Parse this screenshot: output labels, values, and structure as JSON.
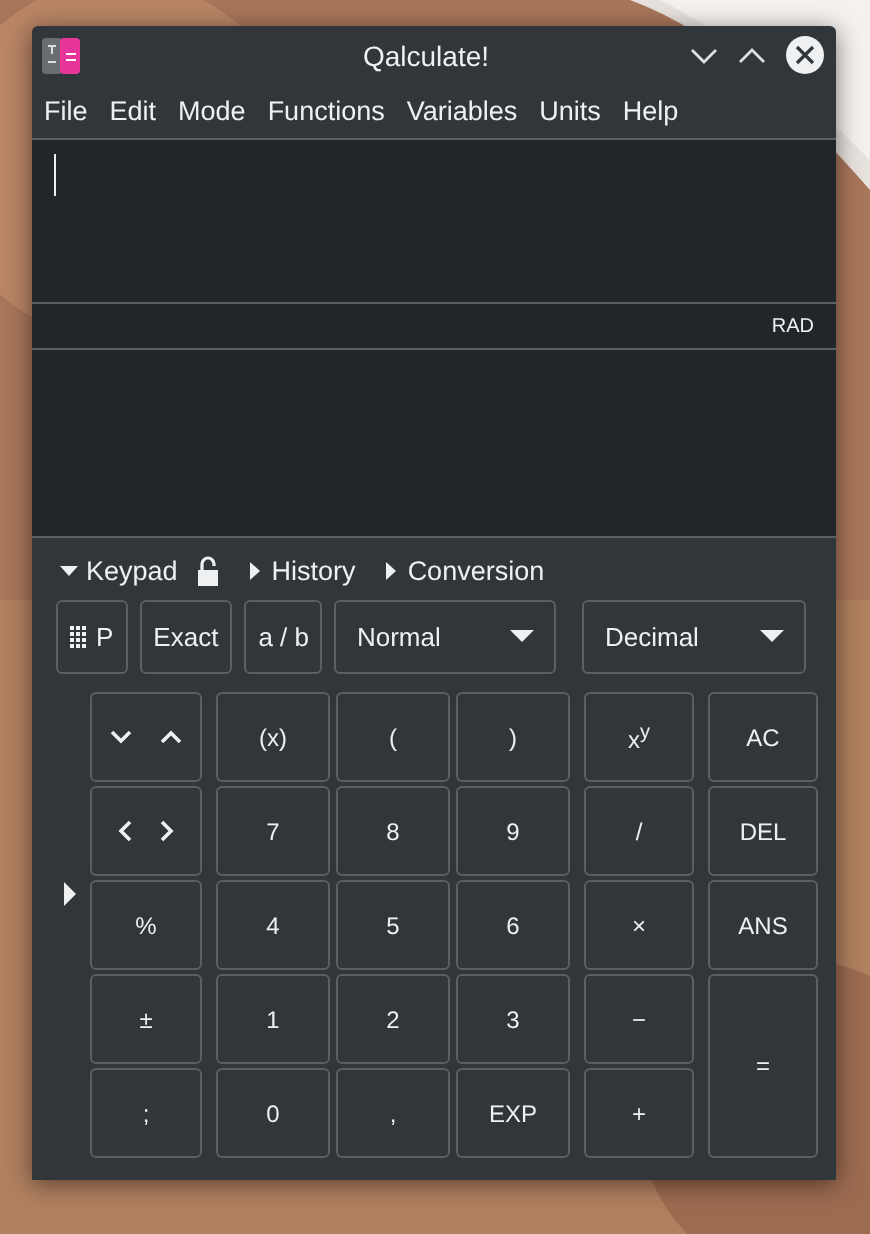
{
  "window": {
    "title": "Qalculate!"
  },
  "menu": [
    "File",
    "Edit",
    "Mode",
    "Functions",
    "Variables",
    "Units",
    "Help"
  ],
  "status": {
    "angle_unit": "RAD"
  },
  "sections": [
    {
      "label": "Keypad",
      "expanded": true
    },
    {
      "label": "History",
      "expanded": false
    },
    {
      "label": "Conversion",
      "expanded": false
    }
  ],
  "keypad_locked": false,
  "toolbar": {
    "buttons": [
      "P",
      "Exact",
      "a / b"
    ],
    "dropdowns": [
      "Normal",
      "Decimal"
    ]
  },
  "left_keys": [
    {
      "kind": "updown"
    },
    {
      "kind": "leftright"
    },
    {
      "kind": "text",
      "label": "%"
    },
    {
      "kind": "text",
      "label": "±"
    },
    {
      "kind": "text",
      "label": ";"
    }
  ],
  "number_keys": [
    "(x)",
    "(",
    ")",
    "7",
    "8",
    "9",
    "4",
    "5",
    "6",
    "1",
    "2",
    "3",
    "0",
    ",",
    "EXP"
  ],
  "operator_keys": [
    "x$^{y}$",
    "/",
    "×",
    "−",
    "+"
  ],
  "right_keys": [
    {
      "label": "AC",
      "kind": "normal"
    },
    {
      "label": "DEL",
      "kind": "normal"
    },
    {
      "label": "ANS",
      "kind": "normal"
    },
    {
      "label": "=",
      "kind": "tall"
    }
  ]
}
